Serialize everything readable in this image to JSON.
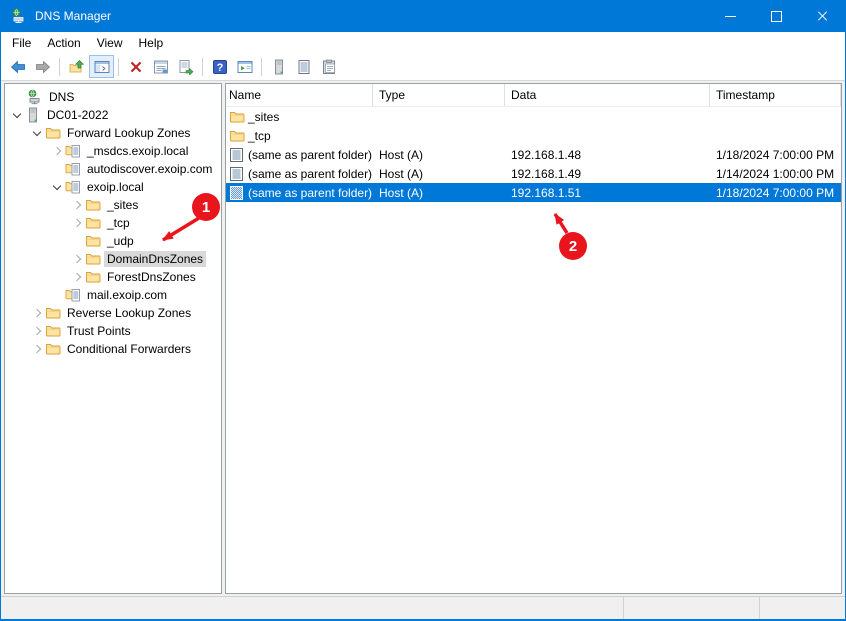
{
  "window": {
    "title": "DNS Manager",
    "controls": [
      "minimize",
      "maximize",
      "close"
    ]
  },
  "menu": {
    "items": [
      "File",
      "Action",
      "View",
      "Help"
    ]
  },
  "toolbar": {
    "items": [
      "back",
      "forward",
      "separator",
      "up-one-level",
      "show-console-tree",
      "separator",
      "delete",
      "properties",
      "export-list",
      "separator",
      "help",
      "new-window",
      "separator",
      "server",
      "record-list",
      "clipboard"
    ]
  },
  "tree": {
    "items": [
      {
        "label": "DNS",
        "level": 0,
        "expander": "none",
        "icon": "dns-root",
        "selected": false
      },
      {
        "label": "DC01-2022",
        "level": 1,
        "expander": "expanded",
        "icon": "server",
        "selected": false
      },
      {
        "label": "Forward Lookup Zones",
        "level": 2,
        "expander": "expanded",
        "icon": "folder",
        "selected": false
      },
      {
        "label": "_msdcs.exoip.local",
        "level": 3,
        "expander": "collapsed",
        "icon": "zone",
        "selected": false
      },
      {
        "label": "autodiscover.exoip.com",
        "level": 3,
        "expander": "none",
        "icon": "zone",
        "selected": false
      },
      {
        "label": "exoip.local",
        "level": 3,
        "expander": "expanded",
        "icon": "zone",
        "selected": false
      },
      {
        "label": "_sites",
        "level": 4,
        "expander": "collapsed",
        "icon": "folder",
        "selected": false
      },
      {
        "label": "_tcp",
        "level": 4,
        "expander": "collapsed",
        "icon": "folder",
        "selected": false
      },
      {
        "label": "_udp",
        "level": 4,
        "expander": "none",
        "icon": "folder",
        "selected": false
      },
      {
        "label": "DomainDnsZones",
        "level": 4,
        "expander": "collapsed",
        "icon": "folder",
        "selected": true
      },
      {
        "label": "ForestDnsZones",
        "level": 4,
        "expander": "collapsed",
        "icon": "folder",
        "selected": false
      },
      {
        "label": "mail.exoip.com",
        "level": 3,
        "expander": "none",
        "icon": "zone",
        "selected": false
      },
      {
        "label": "Reverse Lookup Zones",
        "level": 2,
        "expander": "collapsed",
        "icon": "folder",
        "selected": false
      },
      {
        "label": "Trust Points",
        "level": 2,
        "expander": "collapsed",
        "icon": "folder",
        "selected": false
      },
      {
        "label": "Conditional Forwarders",
        "level": 2,
        "expander": "collapsed",
        "icon": "folder",
        "selected": false
      }
    ]
  },
  "list": {
    "columns": [
      "Name",
      "Type",
      "Data",
      "Timestamp"
    ],
    "rows": [
      {
        "icon": "folder",
        "name": "_sites",
        "type": "",
        "data": "",
        "timestamp": "",
        "selected": false
      },
      {
        "icon": "folder",
        "name": "_tcp",
        "type": "",
        "data": "",
        "timestamp": "",
        "selected": false
      },
      {
        "icon": "record",
        "name": "(same as parent folder)",
        "type": "Host (A)",
        "data": "192.168.1.48",
        "timestamp": "1/18/2024 7:00:00 PM",
        "selected": false
      },
      {
        "icon": "record",
        "name": "(same as parent folder)",
        "type": "Host (A)",
        "data": "192.168.1.49",
        "timestamp": "1/14/2024 1:00:00 PM",
        "selected": false
      },
      {
        "icon": "record",
        "name": "(same as parent folder)",
        "type": "Host (A)",
        "data": "192.168.1.51",
        "timestamp": "1/18/2024 7:00:00 PM",
        "selected": true
      }
    ]
  },
  "annotations": [
    {
      "label": "1",
      "points_to": "DomainDnsZones"
    },
    {
      "label": "2",
      "points_to": "192.168.1.51"
    }
  ],
  "colors": {
    "titlebar_blue": "#0078d7",
    "selection_blue": "#0078d7",
    "tree_selection_gray": "#d9d9d9",
    "annotation_red": "#e8161c",
    "statusbar_gray": "#f0f0f0"
  }
}
